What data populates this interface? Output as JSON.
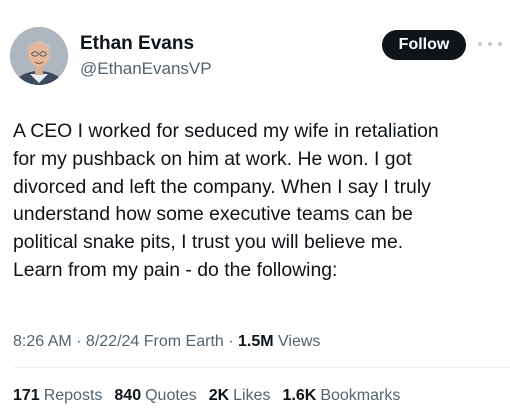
{
  "author": {
    "display_name": "Ethan Evans",
    "handle": "@EthanEvansVP",
    "avatar_icon": "profile-photo"
  },
  "header": {
    "follow_label": "Follow",
    "more_icon": "more-horizontal-icon"
  },
  "tweet": {
    "lines": [
      "A CEO I worked for seduced my wife in retaliation",
      "for my pushback on him at work. He won. I got",
      "divorced and left the company. When I say I truly",
      "understand how some executive teams can be",
      "political snake pits, I trust you will believe me.",
      "Learn from my pain - do the following:"
    ]
  },
  "meta": {
    "time": "8:26 AM",
    "date": "8/22/24",
    "location": "From Earth",
    "views_count": "1.5M",
    "views_label": "Views"
  },
  "stats": {
    "reposts_count": "171",
    "reposts_label": "Reposts",
    "quotes_count": "840",
    "quotes_label": "Quotes",
    "likes_count": "2K",
    "likes_label": "Likes",
    "bookmarks_count": "1.6K",
    "bookmarks_label": "Bookmarks"
  },
  "colors": {
    "text_primary": "#0f1419",
    "text_secondary": "#536471",
    "follow_bg": "#0f1419",
    "follow_text": "#ffffff",
    "divider": "#eff3f4"
  }
}
